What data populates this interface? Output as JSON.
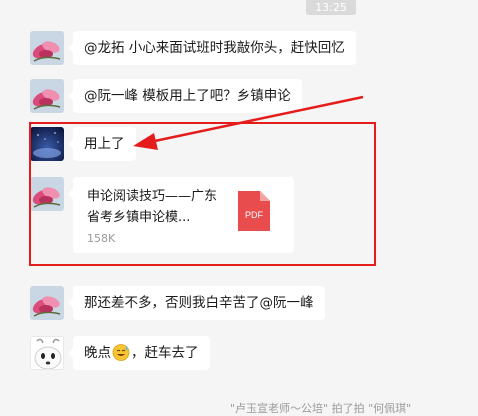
{
  "time_label": "13:25",
  "messages": [
    {
      "text": "@龙拓 小心来面试班时我敲你头，赶快回忆"
    },
    {
      "text": "@阮一峰 模板用上了吧？乡镇申论"
    },
    {
      "text": "用上了"
    },
    {
      "file": {
        "name": "申论阅读技巧——广东省考乡镇申论模...",
        "size": "158K",
        "icon": "pdf-file-icon",
        "icon_label": "PDF",
        "icon_color": "#e84c4c"
      }
    },
    {
      "text": "那还差不多，否则我白辛苦了@阮一峰"
    },
    {
      "text_before": "晚点",
      "emoji": "sweat-smile-emoji",
      "text_after": "，赶车去了"
    }
  ],
  "system_message": "\"卢玉宣老师～公培\" 拍了拍 \"何佩琪\"",
  "colors": {
    "highlight": "#e51c1c",
    "background": "#f5f5f5",
    "bubble": "#ffffff"
  }
}
